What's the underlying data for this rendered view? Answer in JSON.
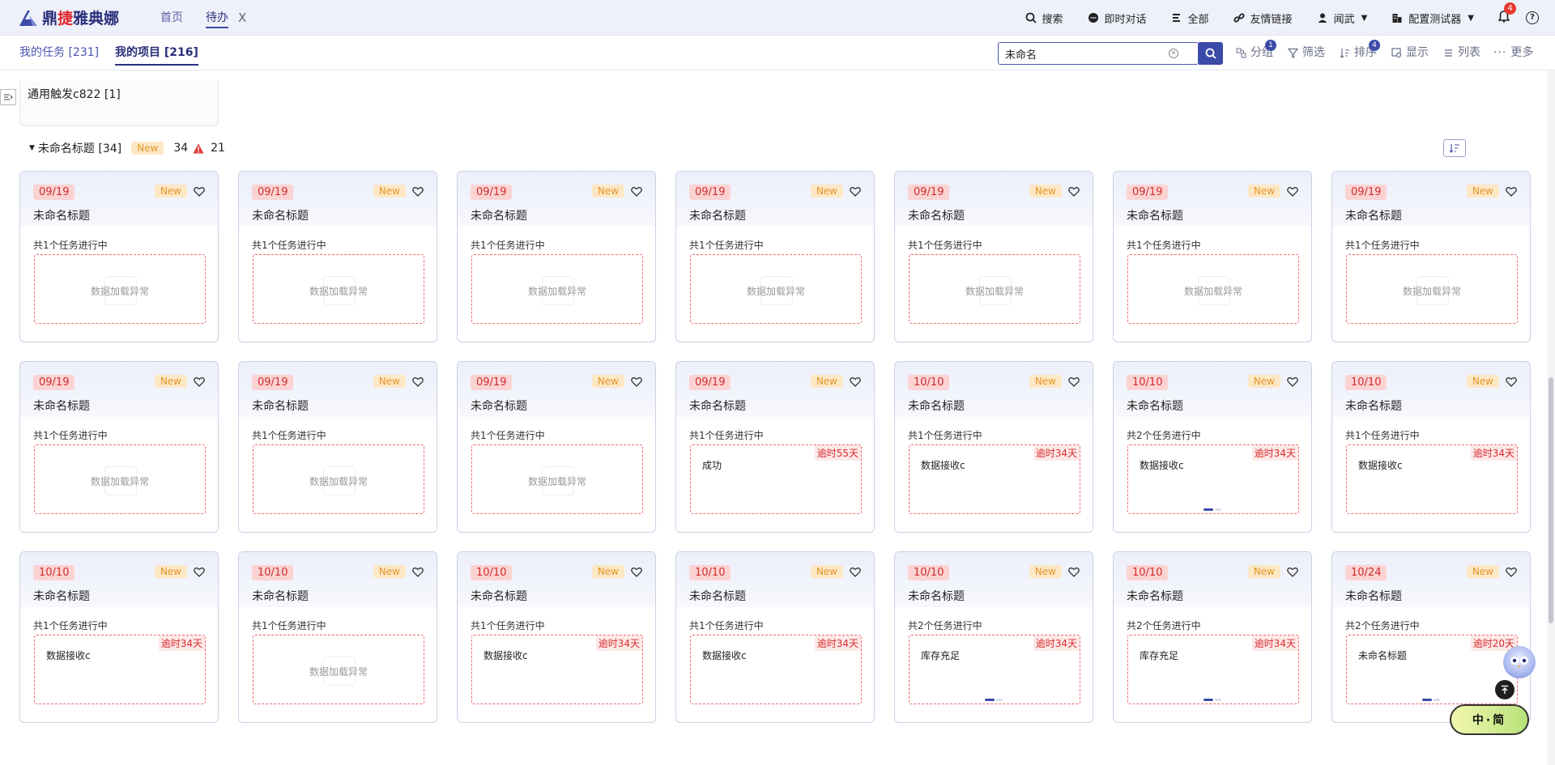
{
  "app": {
    "logo_text_a": "鼎",
    "logo_text_b": "捷",
    "logo_text_c": "雅典娜"
  },
  "topnav": {
    "home": "首页",
    "todo": "待办",
    "close": "X"
  },
  "topright": {
    "search": "搜索",
    "chat": "即时对话",
    "all": "全部",
    "links": "友情链接",
    "user": "闻武",
    "tester": "配置测试器",
    "bell_count": "4",
    "help": "?"
  },
  "subbar": {
    "tab_tasks": "我的任务 [231]",
    "tab_projects": "我的项目 [216]",
    "search_value": "未命名",
    "group": "分组",
    "group_badge": "1",
    "filter": "筛选",
    "sort": "排序",
    "sort_badge": "4",
    "display": "显示",
    "list": "列表",
    "more": "更多"
  },
  "group_box": {
    "label": "通用触发c822 [1]"
  },
  "section": {
    "title": "未命名标题 [34]",
    "new_tag": "New",
    "count": "34",
    "warn_count": "21"
  },
  "cards": [
    {
      "date": "09/19",
      "tag": "New",
      "title": "未命名标题",
      "sub": "共1个任务进行中",
      "type": "error",
      "content": "数据加载异常"
    },
    {
      "date": "09/19",
      "tag": "New",
      "title": "未命名标题",
      "sub": "共1个任务进行中",
      "type": "error",
      "content": "数据加载异常"
    },
    {
      "date": "09/19",
      "tag": "New",
      "title": "未命名标题",
      "sub": "共1个任务进行中",
      "type": "error",
      "content": "数据加载异常"
    },
    {
      "date": "09/19",
      "tag": "New",
      "title": "未命名标题",
      "sub": "共1个任务进行中",
      "type": "error",
      "content": "数据加载异常"
    },
    {
      "date": "09/19",
      "tag": "New",
      "title": "未命名标题",
      "sub": "共1个任务进行中",
      "type": "error",
      "content": "数据加载异常"
    },
    {
      "date": "09/19",
      "tag": "New",
      "title": "未命名标题",
      "sub": "共1个任务进行中",
      "type": "error",
      "content": "数据加载异常"
    },
    {
      "date": "09/19",
      "tag": "New",
      "title": "未命名标题",
      "sub": "共1个任务进行中",
      "type": "error",
      "content": "数据加载异常"
    },
    {
      "date": "09/19",
      "tag": "New",
      "title": "未命名标题",
      "sub": "共1个任务进行中",
      "type": "error",
      "content": "数据加载异常"
    },
    {
      "date": "09/19",
      "tag": "New",
      "title": "未命名标题",
      "sub": "共1个任务进行中",
      "type": "error",
      "content": "数据加载异常"
    },
    {
      "date": "09/19",
      "tag": "New",
      "title": "未命名标题",
      "sub": "共1个任务进行中",
      "type": "error",
      "content": "数据加载异常"
    },
    {
      "date": "09/19",
      "tag": "New",
      "title": "未命名标题",
      "sub": "共1个任务进行中",
      "type": "task",
      "content": "成功",
      "overdue": "逾时55天",
      "dots": false
    },
    {
      "date": "10/10",
      "tag": "New",
      "title": "未命名标题",
      "sub": "共1个任务进行中",
      "type": "task",
      "content": "数据接收c",
      "overdue": "逾时34天",
      "dots": false
    },
    {
      "date": "10/10",
      "tag": "New",
      "title": "未命名标题",
      "sub": "共2个任务进行中",
      "type": "task",
      "content": "数据接收c",
      "overdue": "逾时34天",
      "dots": true
    },
    {
      "date": "10/10",
      "tag": "New",
      "title": "未命名标题",
      "sub": "共1个任务进行中",
      "type": "task",
      "content": "数据接收c",
      "overdue": "逾时34天",
      "dots": false
    },
    {
      "date": "10/10",
      "tag": "New",
      "title": "未命名标题",
      "sub": "共1个任务进行中",
      "type": "task",
      "content": "数据接收c",
      "overdue": "逾时34天",
      "dots": false
    },
    {
      "date": "10/10",
      "tag": "New",
      "title": "未命名标题",
      "sub": "共1个任务进行中",
      "type": "error",
      "content": "数据加载异常"
    },
    {
      "date": "10/10",
      "tag": "New",
      "title": "未命名标题",
      "sub": "共1个任务进行中",
      "type": "task",
      "content": "数据接收c",
      "overdue": "逾时34天",
      "dots": false
    },
    {
      "date": "10/10",
      "tag": "New",
      "title": "未命名标题",
      "sub": "共1个任务进行中",
      "type": "task",
      "content": "数据接收c",
      "overdue": "逾时34天",
      "dots": false
    },
    {
      "date": "10/10",
      "tag": "New",
      "title": "未命名标题",
      "sub": "共2个任务进行中",
      "type": "task",
      "content": "库存充足",
      "overdue": "逾时34天",
      "dots": true
    },
    {
      "date": "10/10",
      "tag": "New",
      "title": "未命名标题",
      "sub": "共2个任务进行中",
      "type": "task",
      "content": "库存充足",
      "overdue": "逾时34天",
      "dots": true
    },
    {
      "date": "10/24",
      "tag": "New",
      "title": "未命名标题",
      "sub": "共2个任务进行中",
      "type": "task",
      "content": "未命名标题",
      "overdue": "逾时20天",
      "dots": true
    }
  ],
  "ime": {
    "text": "中·简"
  },
  "colors": {
    "accent": "#3c4aa8",
    "danger": "#d02c2c",
    "new_bg": "#fde8c6",
    "new_fg": "#e3962a"
  }
}
